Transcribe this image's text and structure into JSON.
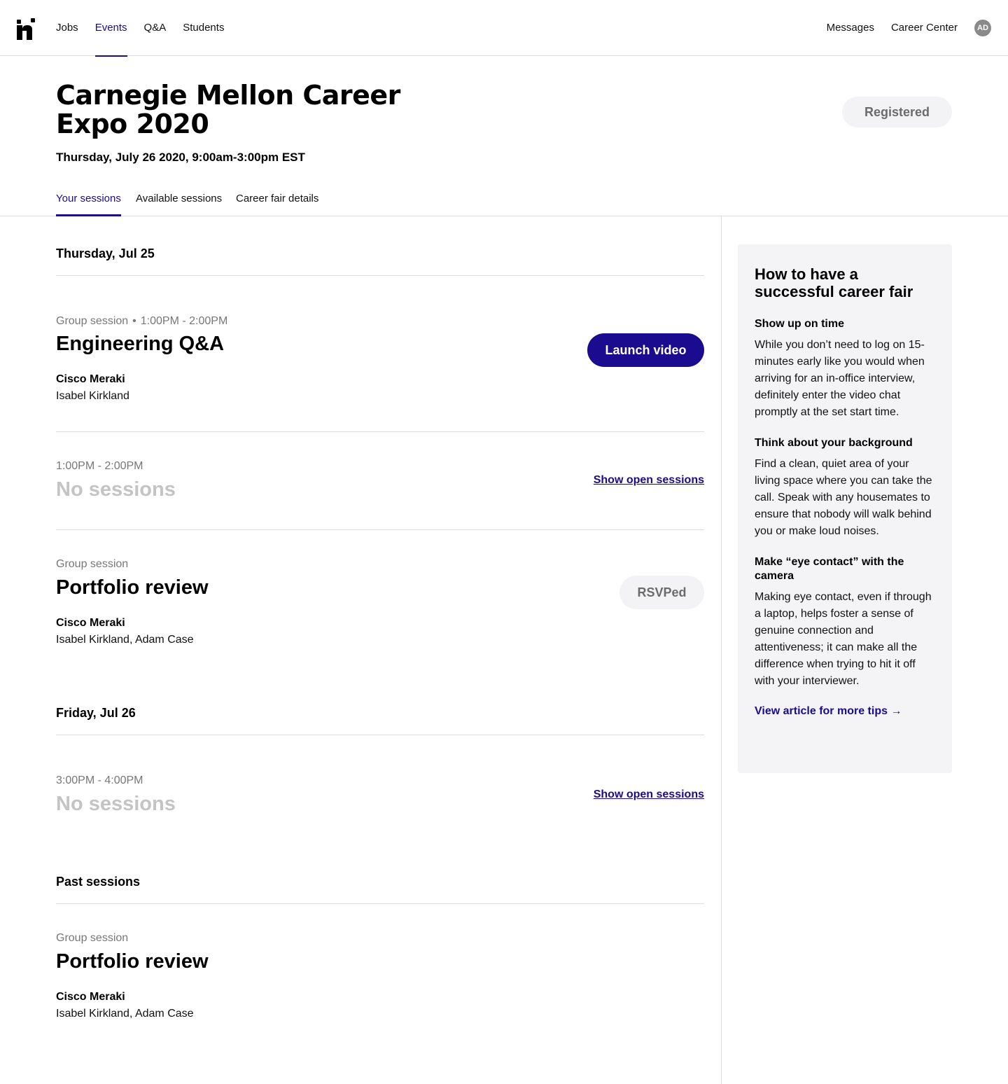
{
  "nav": {
    "left": [
      "Jobs",
      "Events",
      "Q&A",
      "Students"
    ],
    "right": [
      "Messages",
      "Career Center"
    ],
    "avatar_initials": "AD"
  },
  "event": {
    "title": "Carnegie Mellon Career Expo 2020",
    "date": "Thursday, July 26 2020, 9:00am-3:00pm EST",
    "status_button": "Registered"
  },
  "tabs": [
    "Your sessions",
    "Available sessions",
    "Career fair details"
  ],
  "days": [
    {
      "heading": "Thursday, Jul 25",
      "sessions": [
        {
          "type": "Group session",
          "time": "1:00PM - 2:00PM",
          "title": "Engineering Q&A",
          "company": "Cisco Meraki",
          "people": "Isabel Kirkland",
          "action": "Launch video"
        },
        {
          "time": "1:00PM - 2:00PM",
          "title": "No sessions",
          "action": "Show open sessions"
        },
        {
          "type": "Group session",
          "title": "Portfolio review",
          "company": "Cisco Meraki",
          "people": "Isabel Kirkland, Adam Case",
          "action": "RSVPed"
        }
      ]
    },
    {
      "heading": "Friday, Jul 26",
      "sessions": [
        {
          "time": "3:00PM - 4:00PM",
          "title": "No sessions",
          "action": "Show open sessions"
        }
      ]
    }
  ],
  "past": {
    "heading": "Past sessions",
    "sessions": [
      {
        "type": "Group session",
        "title": "Portfolio review",
        "company": "Cisco Meraki",
        "people": "Isabel Kirkland, Adam Case"
      }
    ]
  },
  "tips": {
    "title": "How to have a successful career fair",
    "items": [
      {
        "heading": "Show up on time",
        "body": "While you don’t need to log on 15-minutes early like you would when arriving for an in-office interview, definitely enter the video chat promptly at the set start time."
      },
      {
        "heading": "Think about your background",
        "body": "Find a clean, quiet area of your living space where you can take the call. Speak with any housemates to ensure that nobody will walk behind you or make loud noises."
      },
      {
        "heading": "Make “eye contact” with the camera",
        "body": "Making eye contact, even if through a laptop, helps foster a sense of genuine connection and attentiveness; it can make all the difference when trying to hit it off with your interviewer."
      }
    ],
    "link": "View article for more tips →"
  },
  "colors": {
    "accent": "#1b0b8f",
    "muted_text": "#777777",
    "disabled_title": "#c4c4c4",
    "card_bg": "#f4f4f6"
  },
  "icons": [
    "handshake-logo-icon",
    "user-avatar"
  ]
}
